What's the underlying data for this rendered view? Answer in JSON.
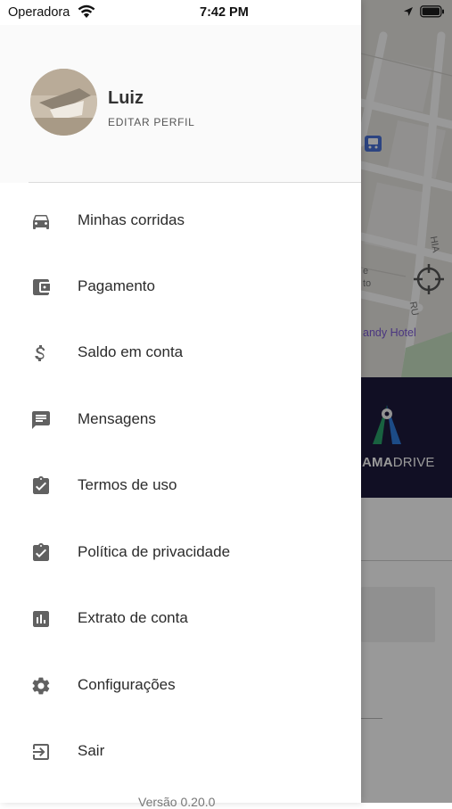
{
  "status_bar": {
    "carrier": "Operadora",
    "time": "7:42 PM"
  },
  "profile": {
    "name": "Luiz",
    "edit_label": "EDITAR PERFIL"
  },
  "menu": [
    {
      "label": "Minhas corridas",
      "icon": "car-icon"
    },
    {
      "label": "Pagamento",
      "icon": "wallet-icon"
    },
    {
      "label": "Saldo em conta",
      "icon": "dollar-icon"
    },
    {
      "label": "Mensagens",
      "icon": "message-icon"
    },
    {
      "label": "Termos de uso",
      "icon": "clipboard-check-icon"
    },
    {
      "label": "Política de privacidade",
      "icon": "clipboard-check-icon"
    },
    {
      "label": "Extrato de conta",
      "icon": "bar-chart-icon"
    },
    {
      "label": "Configurações",
      "icon": "gear-icon"
    },
    {
      "label": "Sair",
      "icon": "exit-icon"
    }
  ],
  "version": "Versão 0.20.0",
  "background": {
    "map_poi_label": "andy Hotel",
    "street_1": "HIA",
    "street_2": "RU",
    "street_3": "e",
    "street_4": "to",
    "brand_bold": "AMA",
    "brand_light": "DRIVE"
  },
  "colors": {
    "icon_gray": "#616161",
    "banner_bg": "#1d1a3d",
    "poi_purple": "#7d5bd6"
  }
}
